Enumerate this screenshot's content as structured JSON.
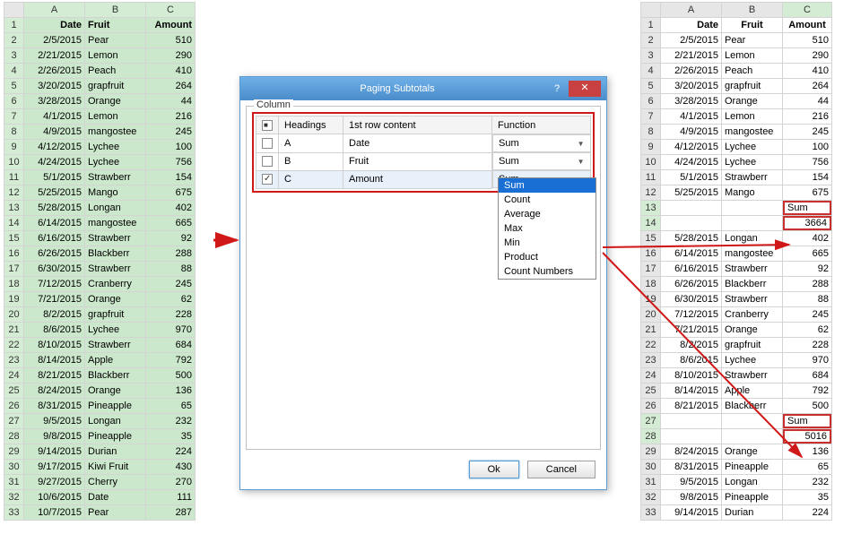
{
  "left": {
    "columns": [
      "A",
      "B",
      "C"
    ],
    "headers": [
      "Date",
      "Fruit",
      "Amount"
    ],
    "rows": [
      [
        "2/5/2015",
        "Pear",
        "510"
      ],
      [
        "2/21/2015",
        "Lemon",
        "290"
      ],
      [
        "2/26/2015",
        "Peach",
        "410"
      ],
      [
        "3/20/2015",
        "grapfruit",
        "264"
      ],
      [
        "3/28/2015",
        "Orange",
        "44"
      ],
      [
        "4/1/2015",
        "Lemon",
        "216"
      ],
      [
        "4/9/2015",
        "mangostee",
        "245"
      ],
      [
        "4/12/2015",
        "Lychee",
        "100"
      ],
      [
        "4/24/2015",
        "Lychee",
        "756"
      ],
      [
        "5/1/2015",
        "Strawberr",
        "154"
      ],
      [
        "5/25/2015",
        "Mango",
        "675"
      ],
      [
        "5/28/2015",
        "Longan",
        "402"
      ],
      [
        "6/14/2015",
        "mangostee",
        "665"
      ],
      [
        "6/16/2015",
        "Strawberr",
        "92"
      ],
      [
        "6/26/2015",
        "Blackberr",
        "288"
      ],
      [
        "6/30/2015",
        "Strawberr",
        "88"
      ],
      [
        "7/12/2015",
        "Cranberry",
        "245"
      ],
      [
        "7/21/2015",
        "Orange",
        "62"
      ],
      [
        "8/2/2015",
        "grapfruit",
        "228"
      ],
      [
        "8/6/2015",
        "Lychee",
        "970"
      ],
      [
        "8/10/2015",
        "Strawberr",
        "684"
      ],
      [
        "8/14/2015",
        "Apple",
        "792"
      ],
      [
        "8/21/2015",
        "Blackberr",
        "500"
      ],
      [
        "8/24/2015",
        "Orange",
        "136"
      ],
      [
        "8/31/2015",
        "Pineapple",
        "65"
      ],
      [
        "9/5/2015",
        "Longan",
        "232"
      ],
      [
        "9/8/2015",
        "Pineapple",
        "35"
      ],
      [
        "9/14/2015",
        "Durian",
        "224"
      ],
      [
        "9/17/2015",
        "Kiwi Fruit",
        "430"
      ],
      [
        "9/27/2015",
        "Cherry",
        "270"
      ],
      [
        "10/6/2015",
        "Date",
        "111"
      ],
      [
        "10/7/2015",
        "Pear",
        "287"
      ]
    ]
  },
  "right": {
    "columns": [
      "A",
      "B",
      "C"
    ],
    "headers": [
      "Date",
      "Fruit",
      "Amount"
    ],
    "rows": [
      {
        "n": "2",
        "d": "2/5/2015",
        "f": "Pear",
        "a": "510"
      },
      {
        "n": "3",
        "d": "2/21/2015",
        "f": "Lemon",
        "a": "290"
      },
      {
        "n": "4",
        "d": "2/26/2015",
        "f": "Peach",
        "a": "410"
      },
      {
        "n": "5",
        "d": "3/20/2015",
        "f": "grapfruit",
        "a": "264"
      },
      {
        "n": "6",
        "d": "3/28/2015",
        "f": "Orange",
        "a": "44"
      },
      {
        "n": "7",
        "d": "4/1/2015",
        "f": "Lemon",
        "a": "216"
      },
      {
        "n": "8",
        "d": "4/9/2015",
        "f": "mangostee",
        "a": "245"
      },
      {
        "n": "9",
        "d": "4/12/2015",
        "f": "Lychee",
        "a": "100"
      },
      {
        "n": "10",
        "d": "4/24/2015",
        "f": "Lychee",
        "a": "756"
      },
      {
        "n": "11",
        "d": "5/1/2015",
        "f": "Strawberr",
        "a": "154"
      },
      {
        "n": "12",
        "d": "5/25/2015",
        "f": "Mango",
        "a": "675"
      },
      {
        "n": "13",
        "d": "",
        "f": "",
        "a": "Sum",
        "sum": true
      },
      {
        "n": "14",
        "d": "",
        "f": "",
        "a": "3664",
        "sum": true
      },
      {
        "n": "15",
        "d": "5/28/2015",
        "f": "Longan",
        "a": "402"
      },
      {
        "n": "16",
        "d": "6/14/2015",
        "f": "mangostee",
        "a": "665"
      },
      {
        "n": "17",
        "d": "6/16/2015",
        "f": "Strawberr",
        "a": "92"
      },
      {
        "n": "18",
        "d": "6/26/2015",
        "f": "Blackberr",
        "a": "288"
      },
      {
        "n": "19",
        "d": "6/30/2015",
        "f": "Strawberr",
        "a": "88"
      },
      {
        "n": "20",
        "d": "7/12/2015",
        "f": "Cranberry",
        "a": "245"
      },
      {
        "n": "21",
        "d": "7/21/2015",
        "f": "Orange",
        "a": "62"
      },
      {
        "n": "22",
        "d": "8/2/2015",
        "f": "grapfruit",
        "a": "228"
      },
      {
        "n": "23",
        "d": "8/6/2015",
        "f": "Lychee",
        "a": "970"
      },
      {
        "n": "24",
        "d": "8/10/2015",
        "f": "Strawberr",
        "a": "684"
      },
      {
        "n": "25",
        "d": "8/14/2015",
        "f": "Apple",
        "a": "792"
      },
      {
        "n": "26",
        "d": "8/21/2015",
        "f": "Blackberr",
        "a": "500"
      },
      {
        "n": "27",
        "d": "",
        "f": "",
        "a": "Sum",
        "sum": true
      },
      {
        "n": "28",
        "d": "",
        "f": "",
        "a": "5016",
        "sum": true
      },
      {
        "n": "29",
        "d": "8/24/2015",
        "f": "Orange",
        "a": "136"
      },
      {
        "n": "30",
        "d": "8/31/2015",
        "f": "Pineapple",
        "a": "65"
      },
      {
        "n": "31",
        "d": "9/5/2015",
        "f": "Longan",
        "a": "232"
      },
      {
        "n": "32",
        "d": "9/8/2015",
        "f": "Pineapple",
        "a": "35"
      },
      {
        "n": "33",
        "d": "9/14/2015",
        "f": "Durian",
        "a": "224"
      }
    ]
  },
  "dialog": {
    "title": "Paging Subtotals",
    "group_label": "Column",
    "grid_headers": [
      "",
      "Headings",
      "1st row content",
      "Function"
    ],
    "grid_rows": [
      {
        "checked": false,
        "heading": "A",
        "content": "Date",
        "function": "Sum"
      },
      {
        "checked": false,
        "heading": "B",
        "content": "Fruit",
        "function": "Sum"
      },
      {
        "checked": true,
        "heading": "C",
        "content": "Amount",
        "function": "Sum"
      }
    ],
    "dropdown_options": [
      "Sum",
      "Count",
      "Average",
      "Max",
      "Min",
      "Product",
      "Count Numbers"
    ],
    "ok_label": "Ok",
    "cancel_label": "Cancel"
  }
}
